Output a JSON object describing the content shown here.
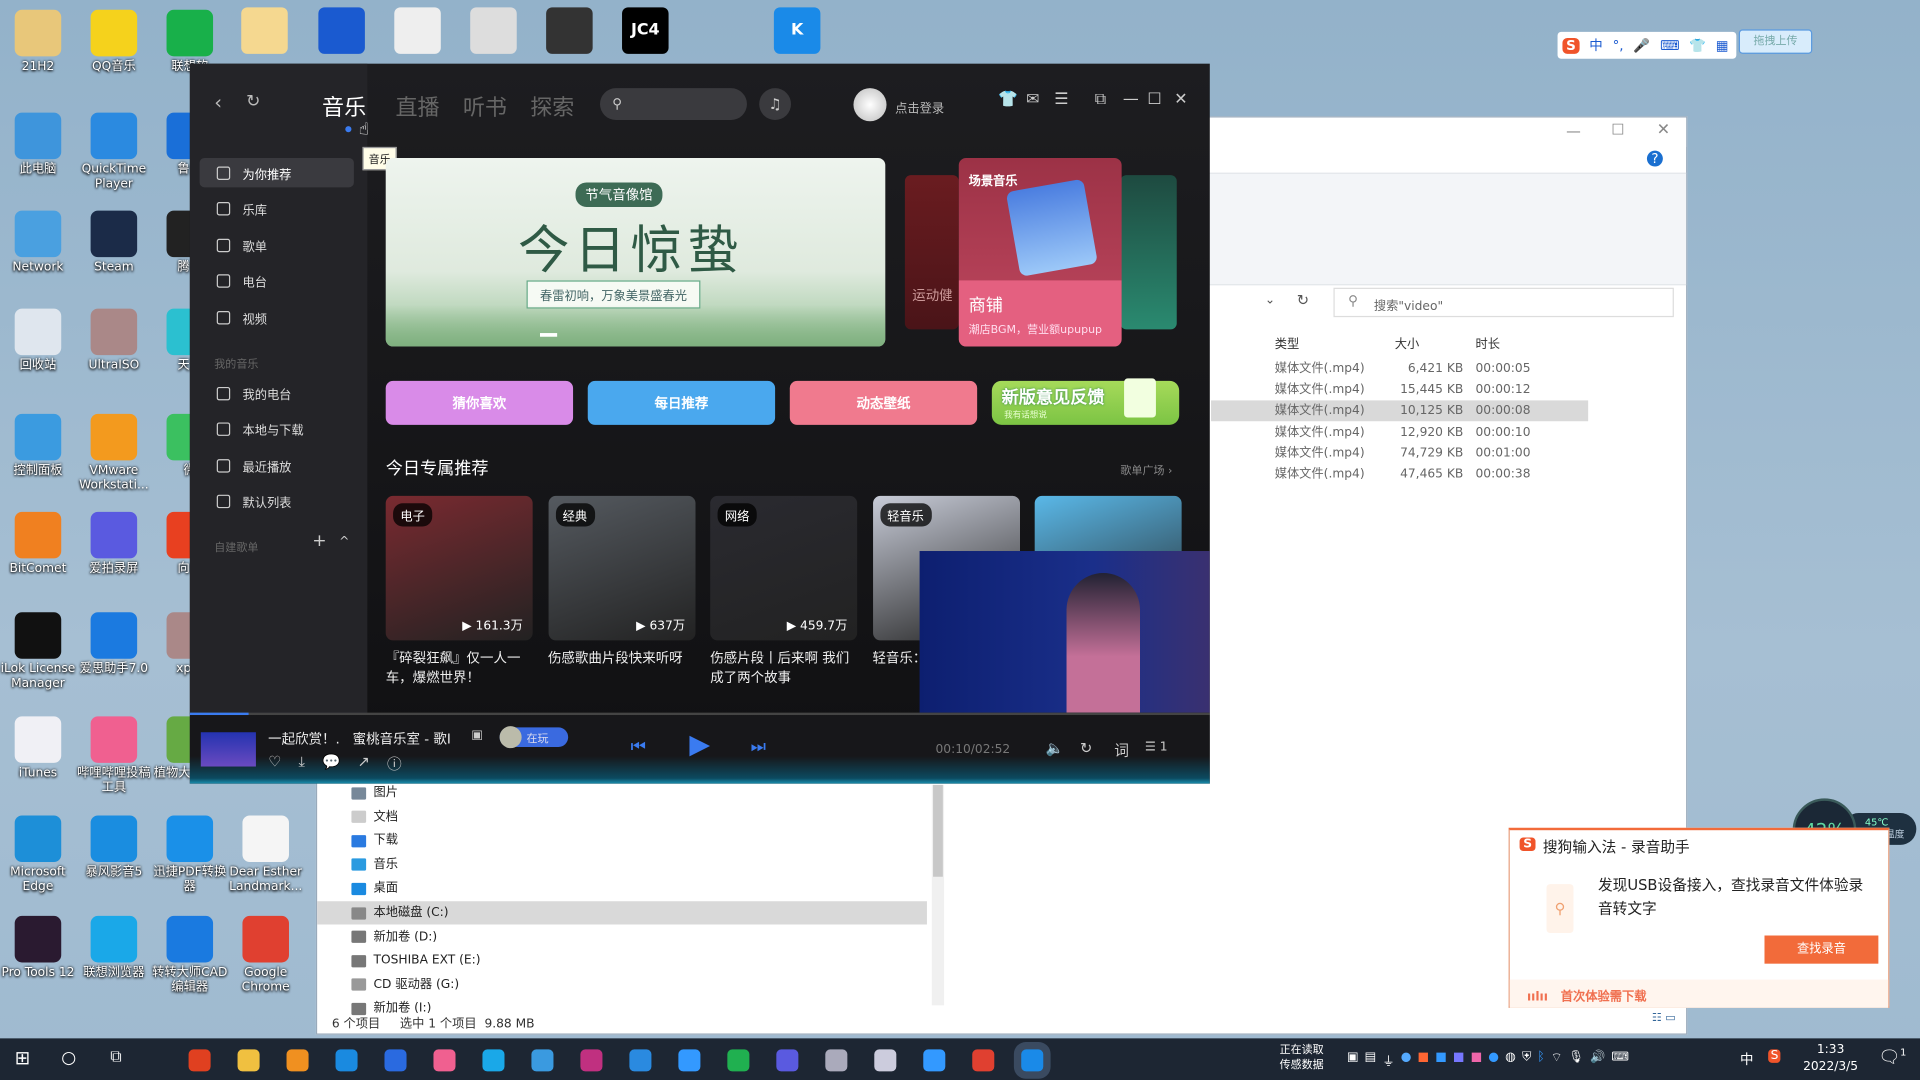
{
  "desktop": {
    "icons": [
      {
        "label": "21H2",
        "color": "#e8c77a"
      },
      {
        "label": "QQ音乐",
        "color": "#f5d21c"
      },
      {
        "label": "联想软",
        "color": "#18b04a"
      },
      {
        "label": "此电脑",
        "color": "#3e95dc"
      },
      {
        "label": "QuickTime Player",
        "color": "#2b8ae0"
      },
      {
        "label": "鲁大",
        "color": "#1a6fd8"
      },
      {
        "label": "Network",
        "color": "#4aa0e0"
      },
      {
        "label": "Steam",
        "color": "#1b2b48"
      },
      {
        "label": "腾讯",
        "color": "#222"
      },
      {
        "label": "回收站",
        "color": "#dfe6ee"
      },
      {
        "label": "UltraISO",
        "color": "#a88"
      },
      {
        "label": "天翼",
        "color": "#2bc0d0"
      },
      {
        "label": "控制面板",
        "color": "#3b9be0"
      },
      {
        "label": "VMware Workstati...",
        "color": "#f39a1e"
      },
      {
        "label": "微",
        "color": "#3bc060"
      },
      {
        "label": "BitComet",
        "color": "#f08020"
      },
      {
        "label": "爱拍录屏",
        "color": "#5a5ae0"
      },
      {
        "label": "向日",
        "color": "#e84020"
      },
      {
        "label": "iLok License Manager",
        "color": "#111"
      },
      {
        "label": "爱思助手7.0",
        "color": "#1b7ae0"
      },
      {
        "label": "xpte",
        "color": "#a88"
      },
      {
        "label": "iTunes",
        "color": "#f0f0f5"
      },
      {
        "label": "哔哩哔哩投稿工具",
        "color": "#f06090"
      },
      {
        "label": "植物大PAK版",
        "color": "#6a4"
      },
      {
        "label": "Microsoft Edge",
        "color": "#1d8fd8"
      },
      {
        "label": "暴风影音5",
        "color": "#1a8de0"
      },
      {
        "label": "迅捷PDF转换器",
        "color": "#1a90e8"
      },
      {
        "label": "Dear Esther Landmark...",
        "color": "#f5f5f5"
      },
      {
        "label": "Pro Tools 12",
        "color": "#2a1a30"
      },
      {
        "label": "联想浏览器",
        "color": "#1aa8e8"
      },
      {
        "label": "转转大师CAD编辑器",
        "color": "#1a7ae0"
      },
      {
        "label": "Google Chrome",
        "color": "#e04030"
      }
    ],
    "top_icons": [
      {
        "color": "#f5d890"
      },
      {
        "color": "#1a5ad0"
      },
      {
        "color": "#eee"
      },
      {
        "color": "#ddd"
      },
      {
        "color": "#333"
      },
      {
        "color": "#000",
        "text": "JC4"
      },
      {
        "color": "#1a8ae8",
        "text": "K"
      }
    ]
  },
  "music": {
    "tabs": [
      "音乐",
      "直播",
      "听书",
      "探索"
    ],
    "tooltip": "音乐",
    "login": "点击登录",
    "sidebar": {
      "items": [
        "为你推荐",
        "乐库",
        "歌单",
        "电台",
        "视频"
      ],
      "group_my": "我的音乐",
      "my_items": [
        "我的电台",
        "本地与下载",
        "最近播放",
        "默认列表"
      ],
      "group_custom": "自建歌单"
    },
    "banner": {
      "badge": "节气音像馆",
      "title": "今日惊蛰",
      "subtitle": "春雷初响，万象美景盛春光"
    },
    "side_cards": {
      "left_label": "运动健",
      "scene_title": "场景音乐",
      "shop_title": "商铺",
      "shop_sub": "潮店BGM，营业额upupup"
    },
    "quick": [
      {
        "label": "猜你喜欢",
        "color": "#d98be8"
      },
      {
        "label": "每日推荐",
        "color": "#4aa8ee"
      },
      {
        "label": "动态壁纸",
        "color": "#f07a8e"
      }
    ],
    "feedback": {
      "title": "新版意见反馈",
      "sub": "我有话想说"
    },
    "section_title": "今日专属推荐",
    "section_more": "歌单广场",
    "cards": [
      {
        "tag": "电子",
        "plays": "161.3万",
        "title": "『碎裂狂飙』仅一人一车，爆燃世界！",
        "color": "#7a2a30"
      },
      {
        "tag": "经典",
        "plays": "637万",
        "title": "伤感歌曲片段快来听呀",
        "color": "#555a60"
      },
      {
        "tag": "网络",
        "plays": "459.7万",
        "title": "伤感片段丨后来啊 我们成了两个故事",
        "color": "#2a2a30"
      },
      {
        "tag": "轻音乐",
        "plays": "",
        "title": "轻音乐：孤独的心",
        "color": "#c8ccd8"
      },
      {
        "tag": "",
        "plays": "",
        "title": "",
        "color": "#5ab8e8"
      }
    ],
    "player": {
      "song": "一起欣赏！.",
      "artist": "蜜桃音乐室 - 歌I",
      "playing_badge": "在玩",
      "time": "00:10/02:52",
      "lyrics": "词",
      "queue": "1",
      "progress": 0.058
    }
  },
  "explorer": {
    "search_placeholder": "搜索\"video\"",
    "columns": [
      "类型",
      "大小",
      "时长"
    ],
    "rows": [
      {
        "type": "媒体文件(.mp4)",
        "size": "6,421 KB",
        "duration": "00:00:05"
      },
      {
        "type": "媒体文件(.mp4)",
        "size": "15,445 KB",
        "duration": "00:00:12"
      },
      {
        "type": "媒体文件(.mp4)",
        "size": "10,125 KB",
        "duration": "00:00:08",
        "selected": true
      },
      {
        "type": "媒体文件(.mp4)",
        "size": "12,920 KB",
        "duration": "00:00:10"
      },
      {
        "type": "媒体文件(.mp4)",
        "size": "74,729 KB",
        "duration": "00:01:00"
      },
      {
        "type": "媒体文件(.mp4)",
        "size": "47,465 KB",
        "duration": "00:00:38"
      }
    ],
    "tree": [
      "图片",
      "文档",
      "下载",
      "音乐",
      "桌面",
      "本地磁盘 (C:)",
      "新加卷 (D:)",
      "TOSHIBA EXT (E:)",
      "CD 驱动器 (G:)",
      "新加卷 (I:)"
    ],
    "status": {
      "count": "6 个项目",
      "selected": "选中 1 个项目",
      "size": "9.88 MB"
    }
  },
  "sogou_bar": {
    "items": [
      "中",
      "°,"
    ],
    "upload": "拖拽上传"
  },
  "popup": {
    "title": "搜狗输入法 - 录音助手",
    "message": "发现USB设备接入，查找录音文件体验录音转文字",
    "button": "查找录音",
    "footer": "首次体验需下载",
    "accent": "#f26b3a"
  },
  "cpu": {
    "usage": "42%",
    "temp": "45℃",
    "label": "CPU温度"
  },
  "taskbar": {
    "sensor": "正在读取传感数据",
    "ime": "中",
    "time": "1:33",
    "date": "2022/3/5",
    "notifications": "1"
  }
}
